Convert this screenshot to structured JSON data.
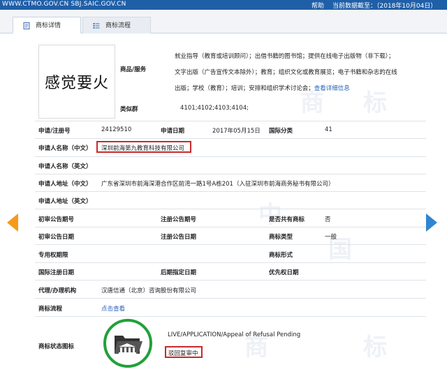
{
  "topbar": {
    "site": "WWW.CTMO.GOV.CN SBJ.SAIC.GOV.CN",
    "help": "帮助",
    "date_text": "当前数据截至：（2018年10月04日）"
  },
  "tabs": [
    {
      "label": "商标详情",
      "active": true
    },
    {
      "label": "商标流程",
      "active": false
    }
  ],
  "trademark": {
    "image_text": "感觉要火",
    "goods_label": "商品/服务",
    "goods_lines": [
      "就业指导（教育或培训顾问）；出借书籍的图书馆；提供在线电子出版物（非下载）；",
      "文字出版（广告宣传文本除外）；教育；组织文化或教育展览；电子书籍和杂志的在线",
      "出版；学校（教育）；培训；安排和组织学术讨论会；"
    ],
    "goods_more_link": "查看详细信息",
    "similar_label": "类似群",
    "similar_value": "4101;4102;4103;4104;"
  },
  "fields": {
    "reg_no_label": "申请/注册号",
    "reg_no_value": "24129510",
    "apply_date_label": "申请日期",
    "apply_date_value": "2017年05月15日",
    "intl_class_label": "国际分类",
    "intl_class_value": "41",
    "applicant_cn_label": "申请人名称（中文）",
    "applicant_cn_value": "深圳前海第九教育科技有限公司",
    "applicant_en_label": "申请人名称（英文）",
    "address_cn_label": "申请人地址（中文）",
    "address_cn_value": "广东省深圳市前海深港合作区前湾一路1号A栋201（入驻深圳市前海商务秘书有限公司）",
    "address_en_label": "申请人地址（英文）",
    "prelim_issue_label": "初审公告期号",
    "reg_issue_label": "注册公告期号",
    "shared_label": "是否共有商标",
    "shared_value": "否",
    "prelim_date_label": "初审公告日期",
    "reg_date_label": "注册公告日期",
    "tm_type_label": "商标类型",
    "tm_type_value": "一般",
    "exclusive_label": "专用权期限",
    "tm_form_label": "商标形式",
    "intl_reg_date_label": "国际注册日期",
    "later_date_label": "后期指定日期",
    "priority_label": "优先权日期",
    "agent_label": "代理/办理机构",
    "agent_value": "汉唐信通（北京）咨询股份有限公司",
    "flow_label": "商标流程",
    "flow_link": "点击查看",
    "status_label": "商标状态图标",
    "status_en": "LIVE/APPLICATION/Appeal of Refusal Pending",
    "status_cn": "驳回复审中"
  },
  "watermark_chars": [
    "商",
    "标",
    "中",
    "国",
    "商",
    "标"
  ],
  "colors": {
    "topbar": "#1f5fa8",
    "link": "#2a62b8",
    "highlight_box": "#c92a2a",
    "status_ring": "#22a03a",
    "arrow_prev": "#f59a1b",
    "arrow_next": "#2e86d1"
  },
  "icons": {
    "tab1": "document-icon",
    "tab2": "list-icon",
    "prev": "arrow-left-icon",
    "next": "arrow-right-icon",
    "status": "folder-courthouse-icon"
  }
}
